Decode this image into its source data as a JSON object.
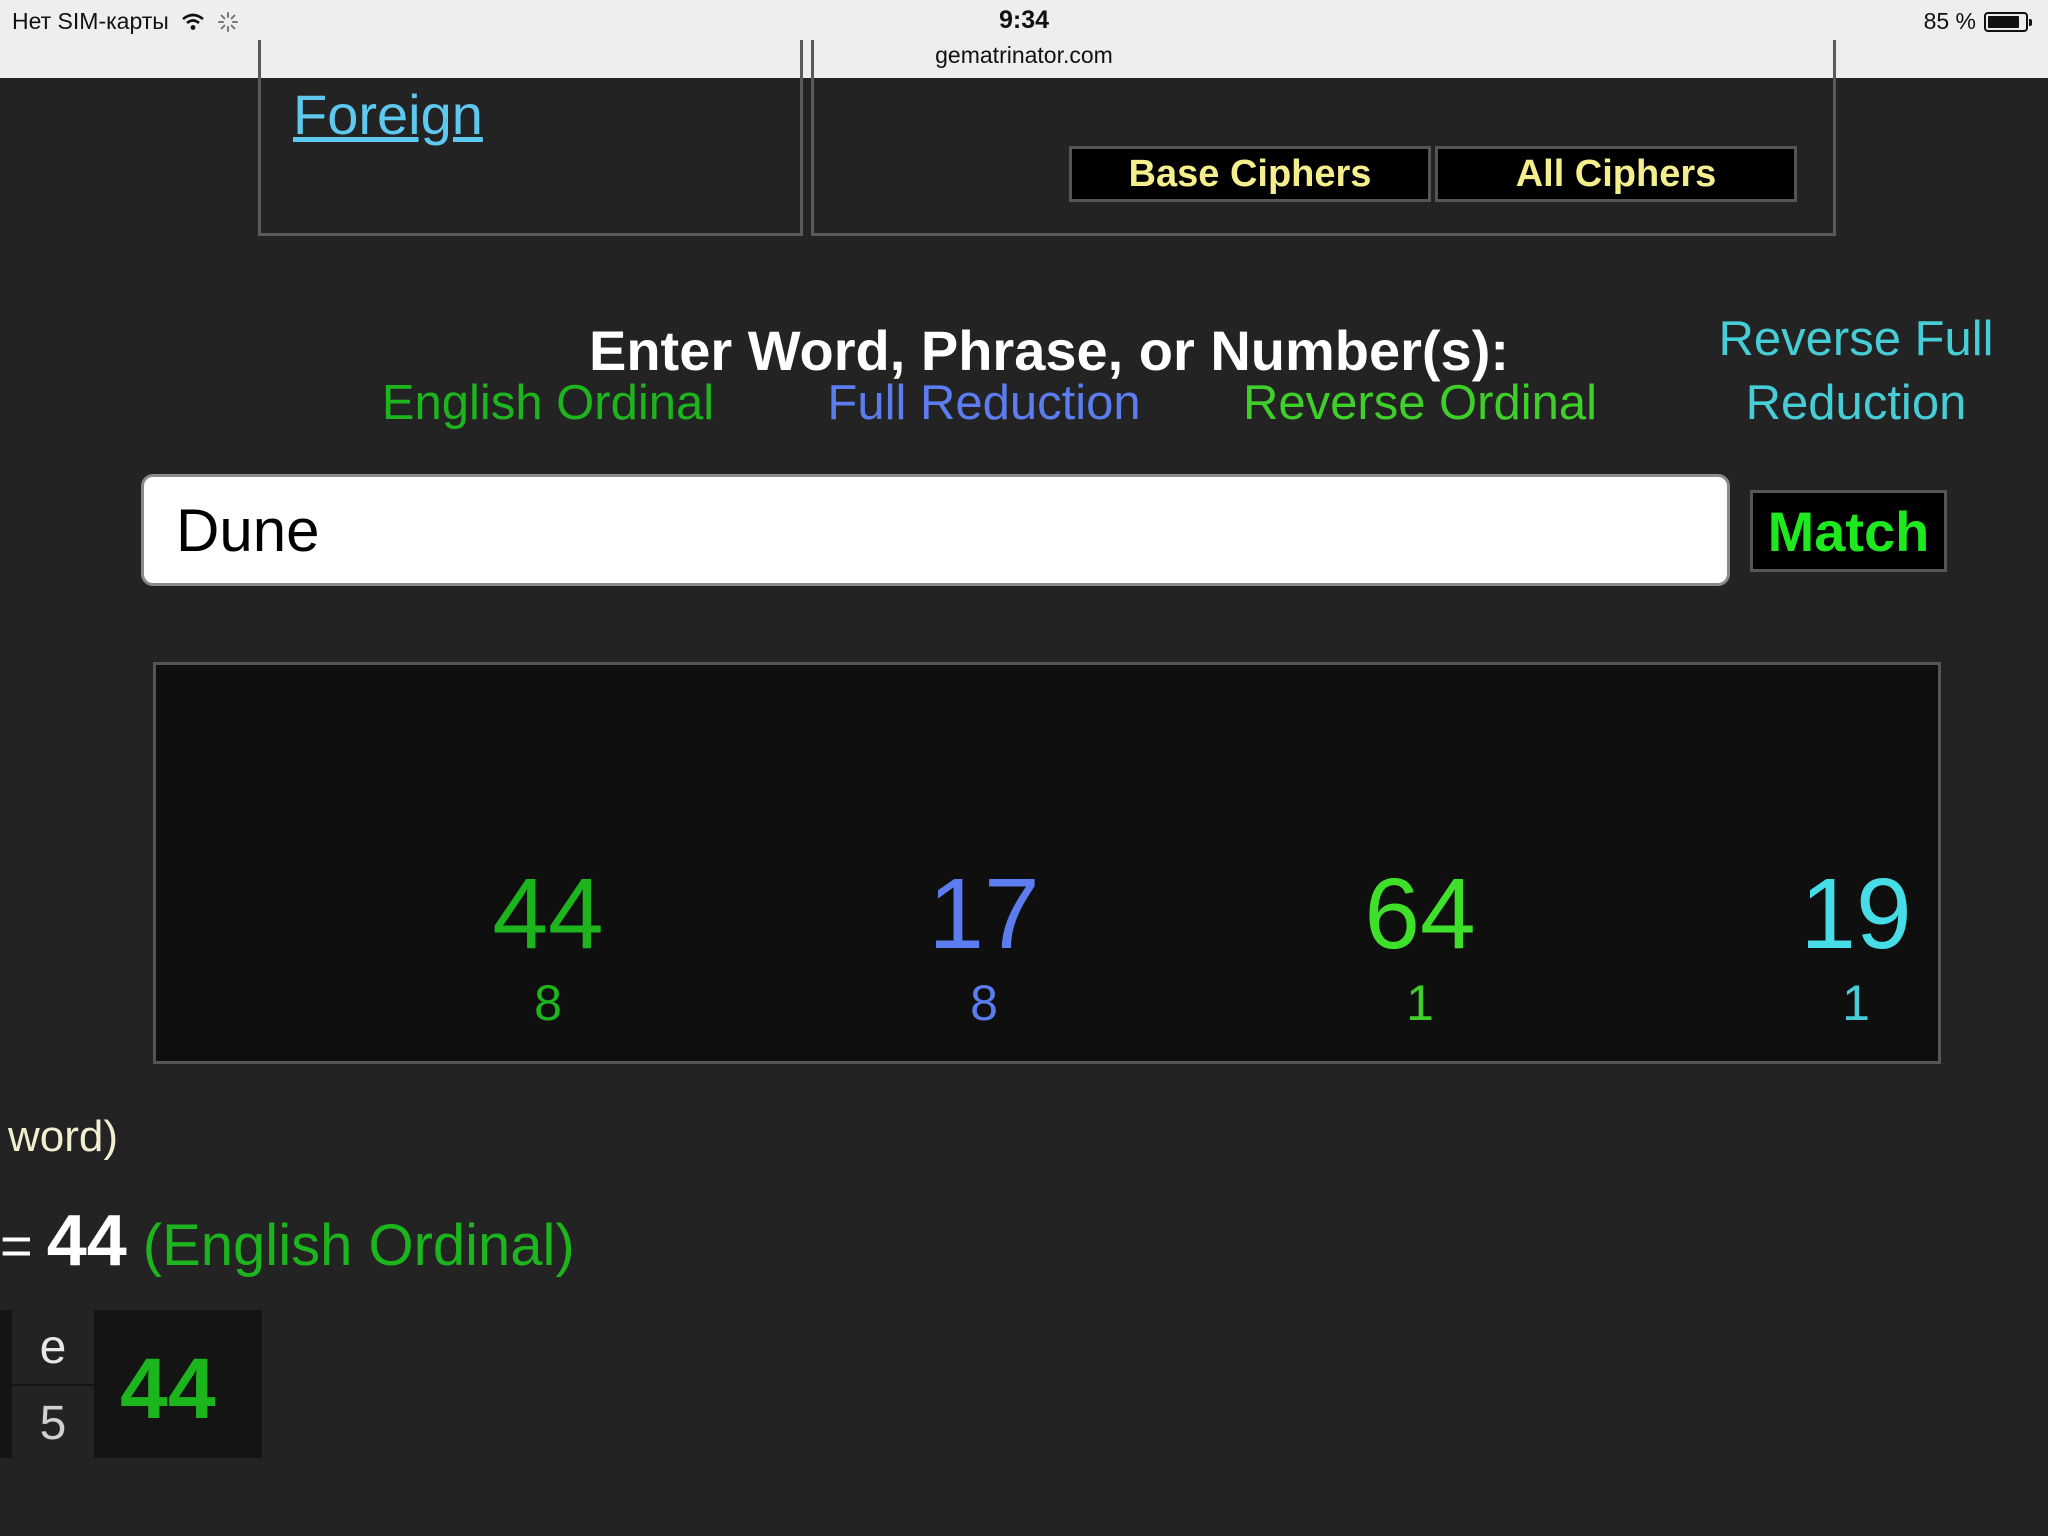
{
  "status_bar": {
    "carrier": "Нет SIM-карты",
    "time": "9:34",
    "url": "gematrinator.com",
    "battery": "85 %",
    "battery_level": 0.85
  },
  "nav": {
    "foreign_link": "Foreign",
    "base_ciphers": "Base Ciphers",
    "all_ciphers": "All Ciphers"
  },
  "prompt": "Enter Word, Phrase, or Number(s):",
  "search": {
    "value": "Dune",
    "match_label": "Match"
  },
  "results": [
    {
      "name": "English Ordinal",
      "value": "44",
      "sub": "8",
      "color": "#1db51d",
      "value_color": "#1db51d",
      "sub_color": "#1db51d"
    },
    {
      "name": "Full Reduction",
      "value": "17",
      "sub": "8",
      "color": "#5b7df0",
      "value_color": "#5b7df0",
      "sub_color": "#5b7df0"
    },
    {
      "name": "Reverse Ordinal",
      "value": "64",
      "sub": "1",
      "color": "#3fcf2a",
      "value_color": "#3fe02a",
      "sub_color": "#3fcf2a"
    },
    {
      "name": "Reverse Full Reduction",
      "value": "19",
      "sub": "1",
      "color": "#46cdd6",
      "value_color": "#46dde6",
      "sub_color": "#46cdd6"
    }
  ],
  "detail": {
    "word_label": "word)",
    "equals": "=",
    "sum": "44",
    "cipher": "(English Ordinal)",
    "letter": "e",
    "letter_value": "5",
    "total": "44"
  }
}
